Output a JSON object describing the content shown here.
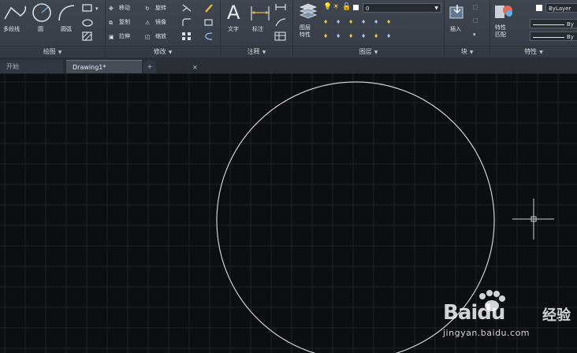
{
  "ribbon": {
    "draw_panel": {
      "title": "绘图",
      "polyline_label": "多段线",
      "circle_label": "圆",
      "arc_label": "圆弧"
    },
    "modify_panel": {
      "title": "修改",
      "move_label": "移动",
      "rotate_label": "旋转",
      "copy_label": "复制",
      "mirror_label": "镜像",
      "stretch_label": "拉伸",
      "scale_label": "缩放"
    },
    "annotation_panel": {
      "title": "注释",
      "text_label": "文字",
      "dimension_label": "标注"
    },
    "layers_panel": {
      "title": "图层",
      "layer_properties_label": "图层\n特性",
      "current_layer": "0"
    },
    "block_panel": {
      "title": "块",
      "insert_label": "插入"
    },
    "properties_panel": {
      "title": "特性",
      "match_label": "特性\n匹配",
      "color_value": "ByLayer",
      "linetype_value": "By",
      "lineweight_value": "By"
    }
  },
  "tabs": [
    {
      "label": "开始"
    },
    {
      "label": "Drawing1*"
    }
  ],
  "tab_close_glyph": "×",
  "tab_add_glyph": "+",
  "watermark": {
    "brand": "Baidu",
    "jingyan": "经验",
    "url": "jingyan.baidu.com"
  },
  "colors": {
    "canvas_bg": "#0d0e10",
    "grid_line": "#1d2127",
    "circle_stroke": "#d0d0d0",
    "ribbon_bg": "#3b424b"
  }
}
